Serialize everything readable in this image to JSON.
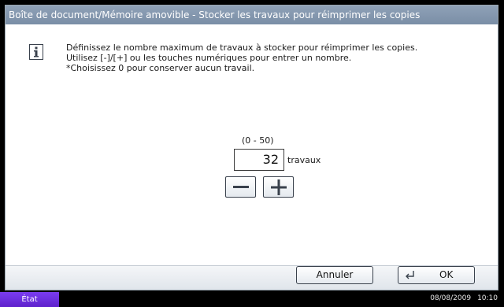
{
  "window": {
    "title": "Boîte de document/Mémoire amovible - Stocker les travaux pour réimprimer les copies"
  },
  "message": {
    "icon": "info-icon",
    "lines": [
      "Définissez le nombre maximum de travaux à stocker pour réimprimer les copies.",
      "Utilisez [-]/[+] ou les touches numériques pour entrer un nombre.",
      "*Choisissez 0 pour conserver aucun travail."
    ]
  },
  "setting": {
    "range": "(0 - 50)",
    "value": "32",
    "unit": "travaux"
  },
  "buttons": {
    "cancel": "Annuler",
    "ok": "OK"
  },
  "status": {
    "label": "État",
    "date": "08/08/2009",
    "time": "10:10"
  },
  "colors": {
    "titlebar": "#7f93ab",
    "status_button": "#6a2ee0"
  }
}
